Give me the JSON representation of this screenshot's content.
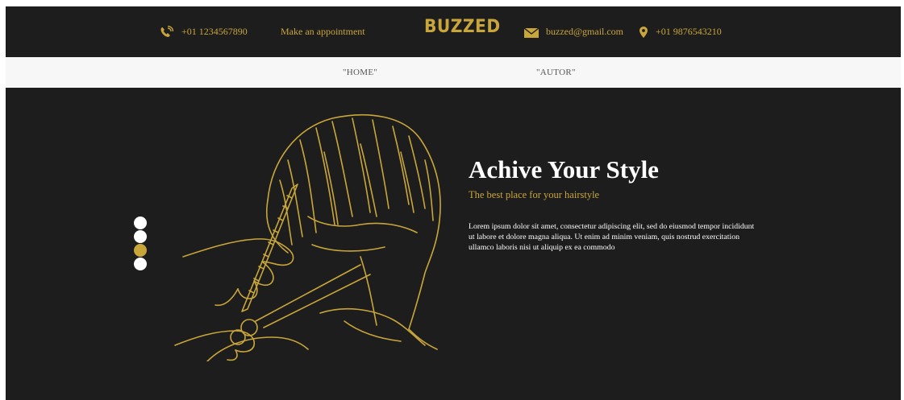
{
  "topbar": {
    "phone1": "+01 1234567890",
    "appointment": "Make an appointment",
    "logo": "BUZZED",
    "email": "buzzed@gmail.com",
    "phone2": "+01 9876543210",
    "icons": [
      "phone-icon",
      "mail-icon",
      "location-pin-icon"
    ]
  },
  "nav": {
    "items": [
      {
        "label": "\"HOME\""
      },
      {
        "label": "\"AUTOR\""
      }
    ]
  },
  "hero": {
    "title": "Achive Your Style",
    "subtitle": "The best place for your hairstyle",
    "body": "Lorem ipsum dolor sit amet, consectetur adipiscing elit, sed do eiusmod tempor incididunt ut labore et dolore magna aliqua. Ut enim ad minim veniam, quis nostrud exercitation ullamco laboris nisi ut aliquip ex ea commodo",
    "slider": {
      "count": 4,
      "active_index": 2
    }
  },
  "colors": {
    "accent": "#c9a63a",
    "dark": "#1d1d1d",
    "nav_bg": "#f7f7f7",
    "white": "#ffffff"
  }
}
